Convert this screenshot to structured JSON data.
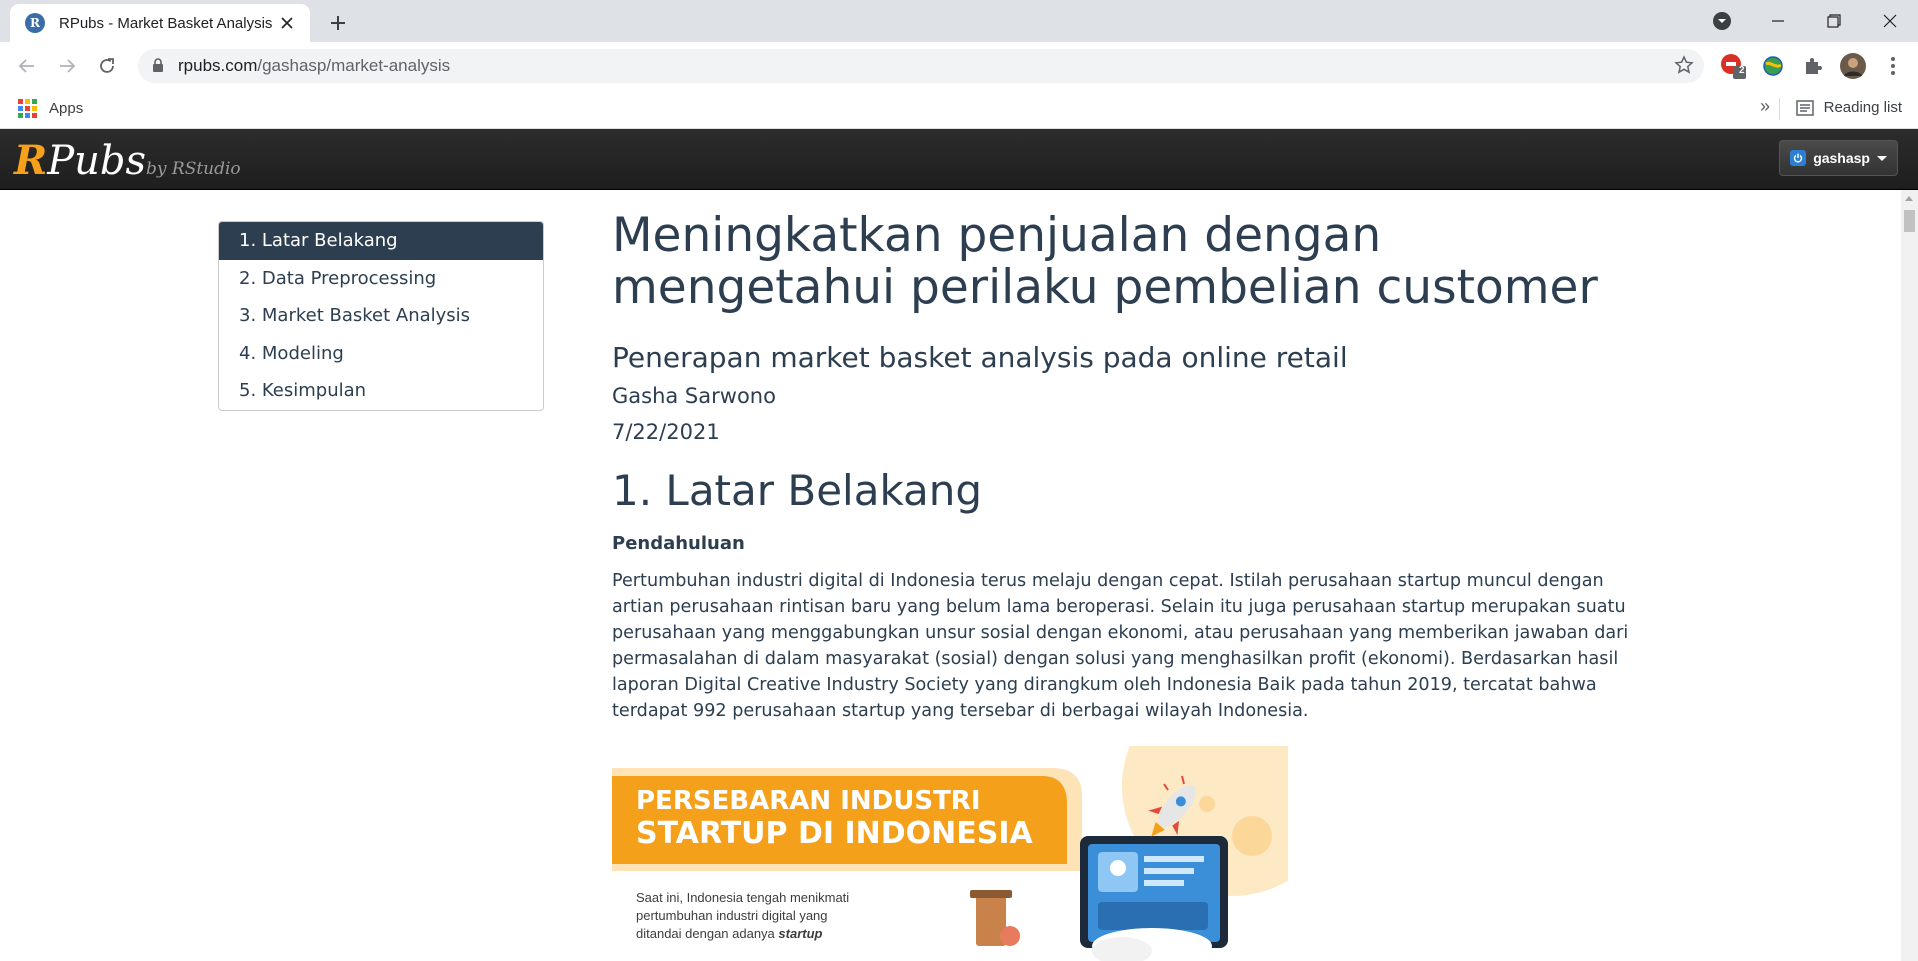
{
  "browser": {
    "tab_title": "RPubs - Market Basket Analysis",
    "url_host": "rpubs.com",
    "url_path": "/gashasp/market-analysis",
    "extension_badge": "2",
    "bookmarks_apps": "Apps",
    "reading_list": "Reading list"
  },
  "rpubs": {
    "logo_r": "R",
    "logo_rest": "Pubs",
    "logo_by": "by RStudio",
    "username": "gashasp"
  },
  "toc": {
    "items": [
      {
        "label": "1. Latar Belakang"
      },
      {
        "label": "2. Data Preprocessing"
      },
      {
        "label": "3. Market Basket Analysis"
      },
      {
        "label": "4. Modeling"
      },
      {
        "label": "5. Kesimpulan"
      }
    ]
  },
  "document": {
    "title": "Meningkatkan penjualan dengan mengetahui perilaku pembelian customer",
    "subtitle": "Penerapan market basket analysis pada online retail",
    "author": "Gasha Sarwono",
    "date": "7/22/2021",
    "section1_heading": "1. Latar Belakang",
    "section1_subheading": "Pendahuluan",
    "section1_paragraph": "Pertumbuhan industri digital di Indonesia terus melaju dengan cepat. Istilah perusahaan startup muncul dengan artian perusahaan rintisan baru yang belum lama beroperasi. Selain itu juga perusahaan startup merupakan suatu perusahaan yang menggabungkan unsur sosial dengan ekonomi, atau perusahaan yang memberikan jawaban dari permasalahan di dalam masyarakat (sosial) dengan solusi yang menghasilkan profit (ekonomi). Berdasarkan hasil laporan Digital Creative Industry Society yang dirangkum oleh Indonesia Baik pada tahun 2019, tercatat bahwa terdapat 992 perusahaan startup yang tersebar di berbagai wilayah Indonesia."
  },
  "infographic": {
    "banner_line1": "PERSEBARAN INDUSTRI",
    "banner_line2": "STARTUP DI INDONESIA",
    "caption_line1": "Saat ini, Indonesia tengah menikmati",
    "caption_line2": "pertumbuhan industri digital yang",
    "caption_line3_prefix": "ditandai dengan adanya ",
    "caption_line3_emph": "startup"
  },
  "colors": {
    "accent_navy": "#2c3e50",
    "rpubs_orange": "#f7a11a",
    "infographic_orange": "#f5a01a"
  }
}
